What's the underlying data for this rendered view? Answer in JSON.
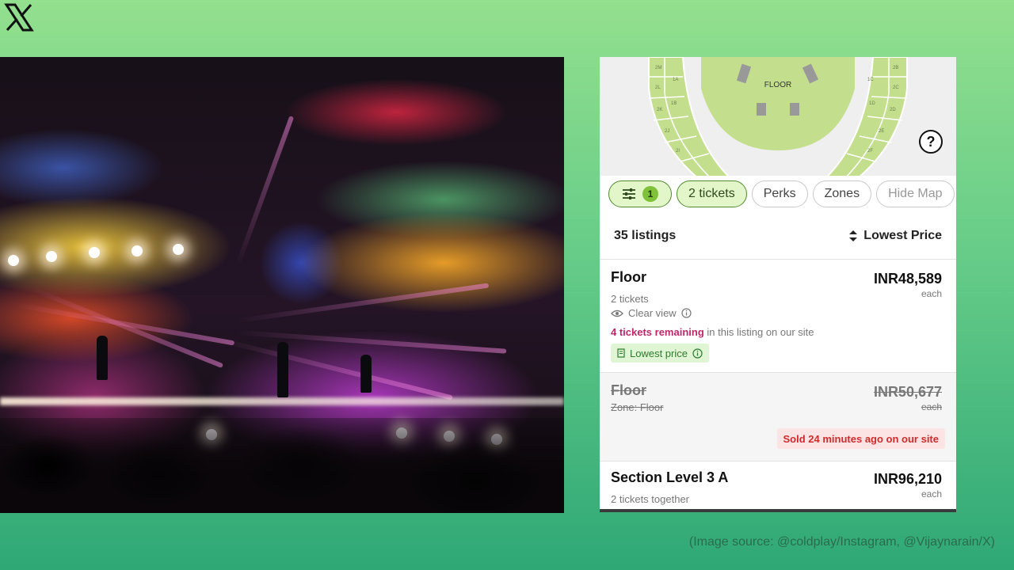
{
  "brand": {
    "logo_icon": "x-logo-icon"
  },
  "photo": {
    "description_icon": "concert-photo"
  },
  "map": {
    "floor_label": "FLOOR",
    "help_symbol": "?"
  },
  "filters": {
    "filter_count": "1",
    "chips": [
      "2 tickets",
      "Perks",
      "Zones",
      "Hide Map"
    ]
  },
  "listings": {
    "count_label": "35 listings",
    "sort_label": "Lowest Price"
  },
  "cards": [
    {
      "name": "Floor",
      "price": "INR48,589",
      "each": "each",
      "tickets": "2 tickets",
      "view": "Clear view",
      "remaining_bold": "4 tickets remaining",
      "remaining_rest": " in this listing on our site",
      "badge": "Lowest price"
    },
    {
      "name": "Floor",
      "zone": "Zone: Floor",
      "price": "INR50,677",
      "each": "each",
      "sold": "Sold 24 minutes ago on our site"
    },
    {
      "name": "Section Level 3 A",
      "price": "INR96,210",
      "each": "each",
      "tickets": "2 tickets together"
    }
  ],
  "credit": "(Image source: @coldplay/Instagram, @Vijaynarain/X)",
  "colors": {
    "background_top": "#93e08e",
    "background_bottom": "#2fa876",
    "chip_active": "#e2f6c9",
    "map_green": "#c3df8e",
    "remaining_pink": "#c0276a",
    "sold_red": "#d02b2b"
  }
}
